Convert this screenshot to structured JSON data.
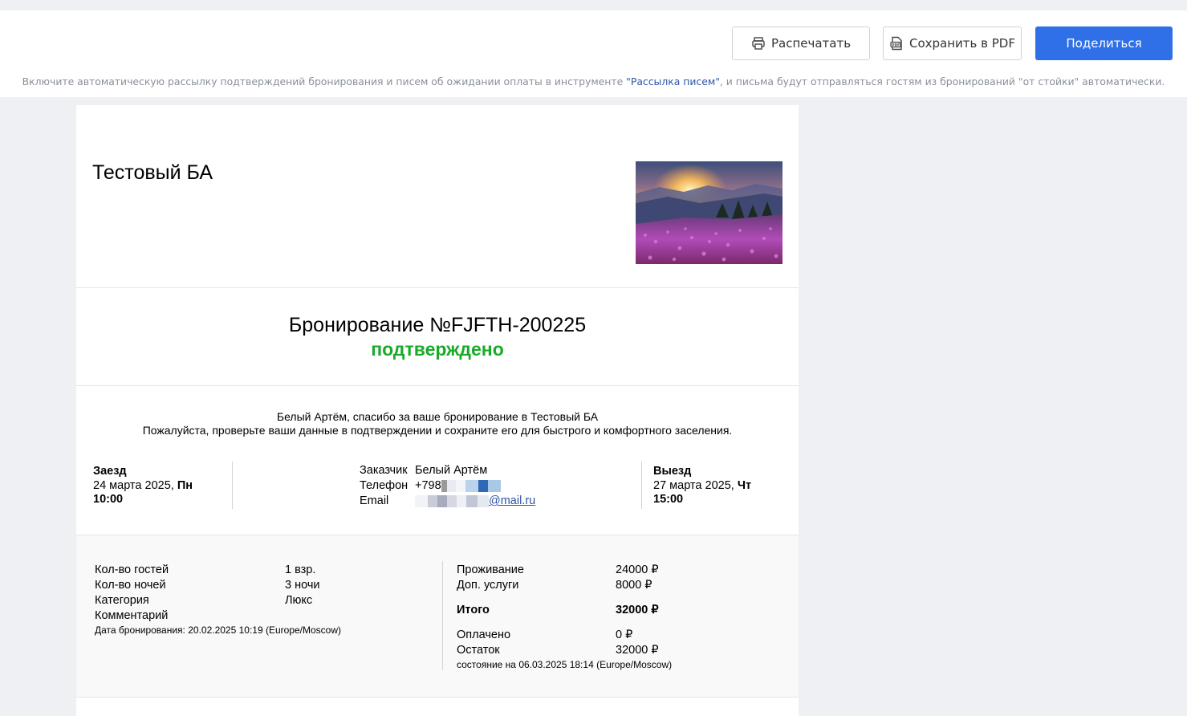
{
  "toolbar": {
    "print_label": "Распечатать",
    "pdf_label": "Сохранить в PDF",
    "share_label": "Поделиться",
    "hint_before": "Включите автоматическую рассылку подтверждений бронирования и писем об ожидании оплаты в инструменте ",
    "hint_link": "\"Рассылка писем\"",
    "hint_after": ", и письма будут отправляться гостям из бронирований \"от стойки\" автоматически."
  },
  "header": {
    "hotel_name": "Тестовый БА"
  },
  "booking": {
    "title": "Бронирование №FJFTH-200225",
    "status": "подтверждено",
    "status_color": "#1aaa2a"
  },
  "thanks": {
    "line1": "Белый Артём, спасибо за ваше бронирование в Тестовый БА",
    "line2": "Пожалуйста, проверьте ваши данные в подтверждении и сохраните его для быстрого и комфортного заселения."
  },
  "checkin": {
    "label": "Заезд",
    "date": "24 марта 2025, ",
    "weekday": "Пн",
    "time": "10:00"
  },
  "customer": {
    "customer_label": "Заказчик",
    "customer_value": "Белый Артём",
    "phone_label": "Телефон",
    "phone_value": "+798",
    "email_label": "Email",
    "email_value": "@mail.ru"
  },
  "checkout": {
    "label": "Выезд",
    "date": "27 марта 2025, ",
    "weekday": "Чт",
    "time": "15:00"
  },
  "summary_left": {
    "guests_label": "Кол-во гостей",
    "guests_value": "1 взр.",
    "nights_label": "Кол-во ночей",
    "nights_value": "3 ночи",
    "category_label": "Категория",
    "category_value": "Люкс",
    "comment_label": "Комментарий",
    "booking_date": "Дата бронирования: 20.02.2025 10:19 (Europe/Moscow)"
  },
  "summary_right": {
    "stay_label": "Проживание",
    "stay_value": "24000 ₽",
    "extra_label": "Доп. услуги",
    "extra_value": "8000 ₽",
    "total_label": "Итого",
    "total_value": "32000 ₽",
    "paid_label": "Оплачено",
    "paid_value": "0 ₽",
    "rest_label": "Остаток",
    "rest_value": "32000 ₽",
    "state_note": "состояние на 06.03.2025 18:14 (Europe/Moscow)"
  }
}
